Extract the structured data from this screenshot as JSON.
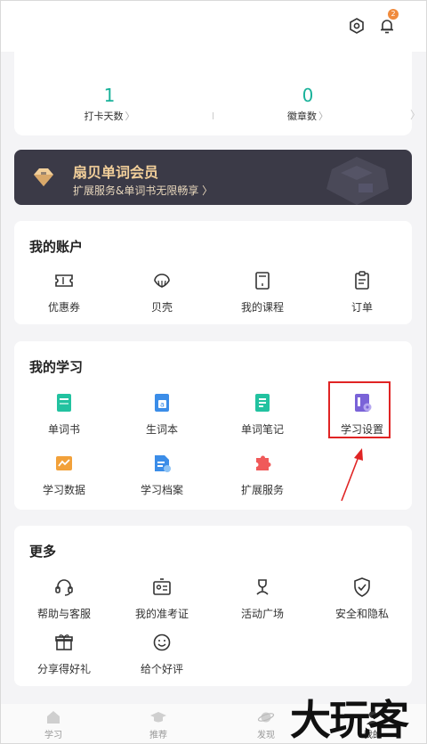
{
  "header": {
    "notification_count": "2"
  },
  "stats": [
    {
      "value": "1",
      "label": "打卡天数"
    },
    {
      "value": "0",
      "label": "徽章数"
    }
  ],
  "member": {
    "title": "扇贝单词会员",
    "subtitle": "扩展服务&单词书无限畅享 〉"
  },
  "account": {
    "title": "我的账户",
    "items": [
      {
        "label": "优惠券",
        "icon": "coupon-icon"
      },
      {
        "label": "贝壳",
        "icon": "shell-icon"
      },
      {
        "label": "我的课程",
        "icon": "course-icon"
      },
      {
        "label": "订单",
        "icon": "order-icon"
      }
    ]
  },
  "study": {
    "title": "我的学习",
    "items": [
      {
        "label": "单词书",
        "icon": "wordbook-icon",
        "color": "#22c2a0"
      },
      {
        "label": "生词本",
        "icon": "vocab-notebook-icon",
        "color": "#3b8de8"
      },
      {
        "label": "单词笔记",
        "icon": "word-notes-icon",
        "color": "#22c2a0"
      },
      {
        "label": "学习设置",
        "icon": "study-settings-icon",
        "color": "#7a63d8"
      },
      {
        "label": "学习数据",
        "icon": "study-data-icon",
        "color": "#f2a13a"
      },
      {
        "label": "学习档案",
        "icon": "study-archive-icon",
        "color": "#3b8de8"
      },
      {
        "label": "扩展服务",
        "icon": "extension-icon",
        "color": "#f05a5a"
      }
    ]
  },
  "more": {
    "title": "更多",
    "items": [
      {
        "label": "帮助与客服",
        "icon": "headset-icon"
      },
      {
        "label": "我的准考证",
        "icon": "admission-ticket-icon"
      },
      {
        "label": "活动广场",
        "icon": "activity-icon"
      },
      {
        "label": "安全和隐私",
        "icon": "shield-icon"
      },
      {
        "label": "分享得好礼",
        "icon": "gift-icon"
      },
      {
        "label": "给个好评",
        "icon": "smile-icon"
      }
    ]
  },
  "tabs": [
    {
      "label": "学习",
      "icon": "home-icon"
    },
    {
      "label": "推荐",
      "icon": "graduation-cap-icon"
    },
    {
      "label": "发现",
      "icon": "planet-icon"
    },
    {
      "label": "我的",
      "icon": "profile-icon",
      "active": true
    }
  ],
  "watermark": "大玩客"
}
